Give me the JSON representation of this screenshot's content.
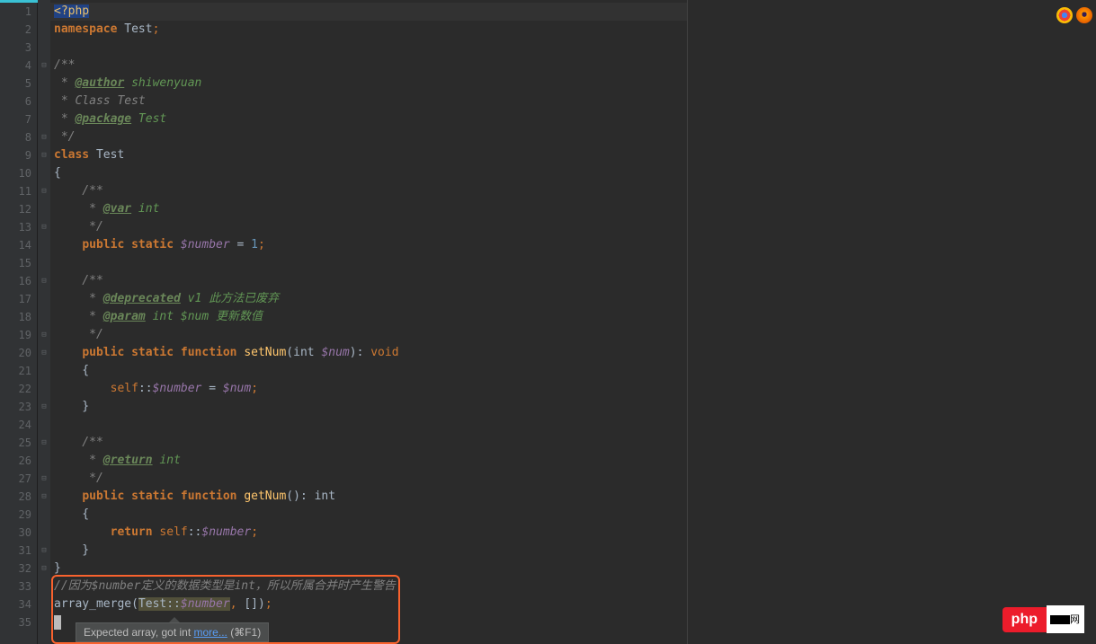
{
  "editor": {
    "lines": [
      {
        "n": 1,
        "fold": "",
        "segs": [
          {
            "c": "tag selected-text",
            "t": "<?php"
          }
        ]
      },
      {
        "n": 2,
        "fold": "",
        "segs": [
          {
            "c": "kw",
            "t": "namespace "
          },
          {
            "c": "ident",
            "t": "Test"
          },
          {
            "c": "semi",
            "t": ";"
          }
        ]
      },
      {
        "n": 3,
        "fold": "",
        "segs": []
      },
      {
        "n": 4,
        "fold": "⊟",
        "segs": [
          {
            "c": "comment",
            "t": "/**"
          }
        ]
      },
      {
        "n": 5,
        "fold": "",
        "segs": [
          {
            "c": "comment",
            "t": " * "
          },
          {
            "c": "doctag",
            "t": "@author"
          },
          {
            "c": "doctext",
            "t": " shiwenyuan"
          }
        ]
      },
      {
        "n": 6,
        "fold": "",
        "segs": [
          {
            "c": "comment",
            "t": " * Class Test"
          }
        ]
      },
      {
        "n": 7,
        "fold": "",
        "segs": [
          {
            "c": "comment",
            "t": " * "
          },
          {
            "c": "doctag",
            "t": "@package"
          },
          {
            "c": "doctext",
            "t": " Test"
          }
        ]
      },
      {
        "n": 8,
        "fold": "⊟",
        "segs": [
          {
            "c": "comment",
            "t": " */"
          }
        ]
      },
      {
        "n": 9,
        "fold": "⊟",
        "segs": [
          {
            "c": "kw",
            "t": "class "
          },
          {
            "c": "classname",
            "t": "Test"
          }
        ]
      },
      {
        "n": 10,
        "fold": "",
        "segs": [
          {
            "c": "punct",
            "t": "{"
          }
        ]
      },
      {
        "n": 11,
        "fold": "⊟",
        "segs": [
          {
            "c": "comment",
            "t": "    /**"
          }
        ]
      },
      {
        "n": 12,
        "fold": "",
        "segs": [
          {
            "c": "comment",
            "t": "     * "
          },
          {
            "c": "doctag",
            "t": "@var"
          },
          {
            "c": "doctext",
            "t": " int"
          }
        ]
      },
      {
        "n": 13,
        "fold": "⊟",
        "segs": [
          {
            "c": "comment",
            "t": "     */"
          }
        ]
      },
      {
        "n": 14,
        "fold": "",
        "segs": [
          {
            "c": "ident",
            "t": "    "
          },
          {
            "c": "kw",
            "t": "public static "
          },
          {
            "c": "var",
            "t": "$number"
          },
          {
            "c": "ident",
            "t": " = "
          },
          {
            "c": "num",
            "t": "1"
          },
          {
            "c": "semi",
            "t": ";"
          }
        ]
      },
      {
        "n": 15,
        "fold": "",
        "segs": []
      },
      {
        "n": 16,
        "fold": "⊟",
        "segs": [
          {
            "c": "comment",
            "t": "    /**"
          }
        ]
      },
      {
        "n": 17,
        "fold": "",
        "segs": [
          {
            "c": "comment",
            "t": "     * "
          },
          {
            "c": "doctag",
            "t": "@deprecated"
          },
          {
            "c": "doctext",
            "t": " v1 此方法已废弃"
          }
        ]
      },
      {
        "n": 18,
        "fold": "",
        "segs": [
          {
            "c": "comment",
            "t": "     * "
          },
          {
            "c": "doctag",
            "t": "@param"
          },
          {
            "c": "doctext",
            "t": " int $num 更新数值"
          }
        ]
      },
      {
        "n": 19,
        "fold": "⊟",
        "segs": [
          {
            "c": "comment",
            "t": "     */"
          }
        ]
      },
      {
        "n": 20,
        "fold": "⊟",
        "segs": [
          {
            "c": "ident",
            "t": "    "
          },
          {
            "c": "kw",
            "t": "public static function "
          },
          {
            "c": "funcname",
            "t": "setNum"
          },
          {
            "c": "punct",
            "t": "("
          },
          {
            "c": "type",
            "t": "int "
          },
          {
            "c": "var",
            "t": "$num"
          },
          {
            "c": "punct",
            "t": "): "
          },
          {
            "c": "kw2",
            "t": "void"
          }
        ]
      },
      {
        "n": 21,
        "fold": "",
        "segs": [
          {
            "c": "punct",
            "t": "    {"
          }
        ]
      },
      {
        "n": 22,
        "fold": "",
        "segs": [
          {
            "c": "ident",
            "t": "        "
          },
          {
            "c": "kw2",
            "t": "self"
          },
          {
            "c": "punct",
            "t": "::"
          },
          {
            "c": "var",
            "t": "$number"
          },
          {
            "c": "ident",
            "t": " = "
          },
          {
            "c": "var",
            "t": "$num"
          },
          {
            "c": "semi",
            "t": ";"
          }
        ]
      },
      {
        "n": 23,
        "fold": "⊟",
        "segs": [
          {
            "c": "punct",
            "t": "    }"
          }
        ]
      },
      {
        "n": 24,
        "fold": "",
        "segs": []
      },
      {
        "n": 25,
        "fold": "⊟",
        "segs": [
          {
            "c": "comment",
            "t": "    /**"
          }
        ]
      },
      {
        "n": 26,
        "fold": "",
        "segs": [
          {
            "c": "comment",
            "t": "     * "
          },
          {
            "c": "doctag",
            "t": "@return"
          },
          {
            "c": "doctext",
            "t": " int"
          }
        ]
      },
      {
        "n": 27,
        "fold": "⊟",
        "segs": [
          {
            "c": "comment",
            "t": "     */"
          }
        ]
      },
      {
        "n": 28,
        "fold": "⊟",
        "segs": [
          {
            "c": "ident",
            "t": "    "
          },
          {
            "c": "kw",
            "t": "public static function "
          },
          {
            "c": "funcname",
            "t": "getNum"
          },
          {
            "c": "punct",
            "t": "(): "
          },
          {
            "c": "type",
            "t": "int"
          }
        ]
      },
      {
        "n": 29,
        "fold": "",
        "segs": [
          {
            "c": "punct",
            "t": "    {"
          }
        ]
      },
      {
        "n": 30,
        "fold": "",
        "segs": [
          {
            "c": "ident",
            "t": "        "
          },
          {
            "c": "kw",
            "t": "return "
          },
          {
            "c": "kw2",
            "t": "self"
          },
          {
            "c": "punct",
            "t": "::"
          },
          {
            "c": "var",
            "t": "$number"
          },
          {
            "c": "semi",
            "t": ";"
          }
        ]
      },
      {
        "n": 31,
        "fold": "⊟",
        "segs": [
          {
            "c": "punct",
            "t": "    }"
          }
        ]
      },
      {
        "n": 32,
        "fold": "⊟",
        "segs": [
          {
            "c": "punct",
            "t": "}"
          }
        ]
      },
      {
        "n": 33,
        "fold": "",
        "segs": [
          {
            "c": "comment",
            "t": "//因为$number定义的数据类型是int，所以所属合并时产生警告"
          }
        ]
      },
      {
        "n": 34,
        "fold": "",
        "segs": [
          {
            "c": "funccall",
            "t": "array_merge"
          },
          {
            "c": "punct",
            "t": "("
          },
          {
            "c": "warn-highlight",
            "t": "Test::"
          },
          {
            "c": "var warn-highlight",
            "t": "$number"
          },
          {
            "c": "semi",
            "t": ", "
          },
          {
            "c": "punct",
            "t": "[])"
          },
          {
            "c": "semi",
            "t": ";"
          }
        ]
      },
      {
        "n": 35,
        "fold": "",
        "caret": true,
        "segs": []
      }
    ]
  },
  "tooltip": {
    "text": "Expected array, got int ",
    "link": "more...",
    "shortcut": " (⌘F1)"
  },
  "watermark": {
    "brand": "php",
    "suffix": "网"
  }
}
